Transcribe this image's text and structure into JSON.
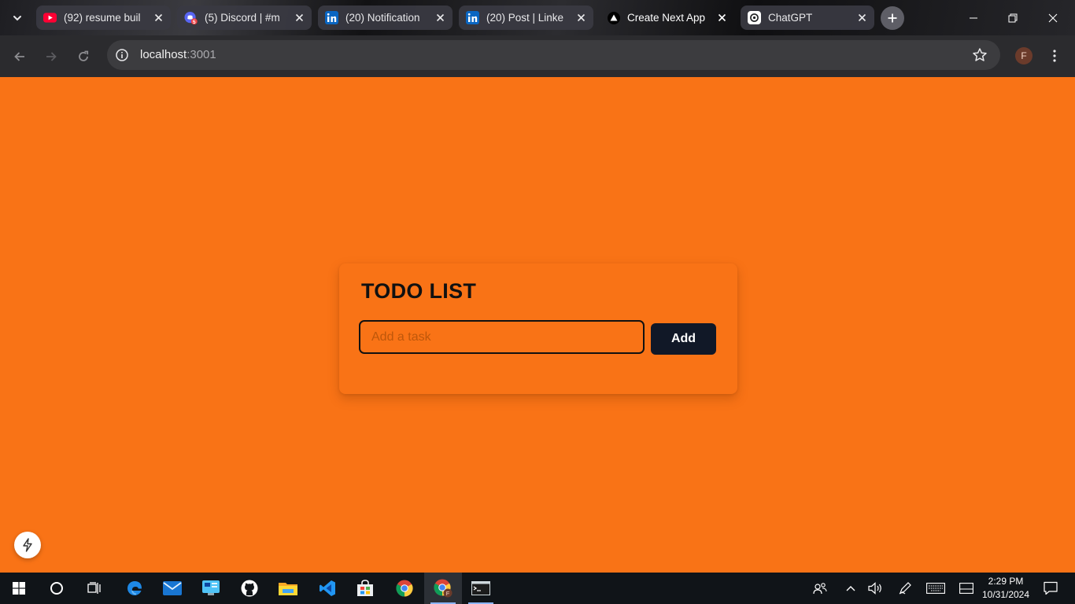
{
  "browser": {
    "tabs": [
      {
        "title": "(92) resume buil",
        "favicon": "youtube-icon",
        "active": false
      },
      {
        "title": "(5) Discord | #m",
        "favicon": "discord-icon",
        "active": false
      },
      {
        "title": "(20) Notification",
        "favicon": "linkedin-icon",
        "active": false
      },
      {
        "title": "(20) Post | Linke",
        "favicon": "linkedin-icon",
        "active": false
      },
      {
        "title": "Create Next App",
        "favicon": "vercel-triangle-icon",
        "active": true
      },
      {
        "title": "ChatGPT",
        "favicon": "chatgpt-icon",
        "active": false
      }
    ],
    "address": {
      "host": "localhost",
      "port": ":3001"
    },
    "profile_initial": "F"
  },
  "todo": {
    "title": "TODO LIST",
    "input_placeholder": "Add a task",
    "input_value": "",
    "add_label": "Add"
  },
  "taskbar": {
    "apps": [
      "windows-start-icon",
      "search-circle-icon",
      "task-view-icon",
      "edge-icon",
      "mail-icon",
      "control-panel-icon",
      "github-icon",
      "file-explorer-icon",
      "vscode-icon",
      "store-icon",
      "chrome-icon",
      "chrome-profile-icon",
      "terminal-icon"
    ],
    "time": "2:29 PM",
    "date": "10/31/2024"
  },
  "colors": {
    "page_bg": "#f97316",
    "button_bg": "#111827",
    "chrome_bg": "#2b2b2e"
  }
}
